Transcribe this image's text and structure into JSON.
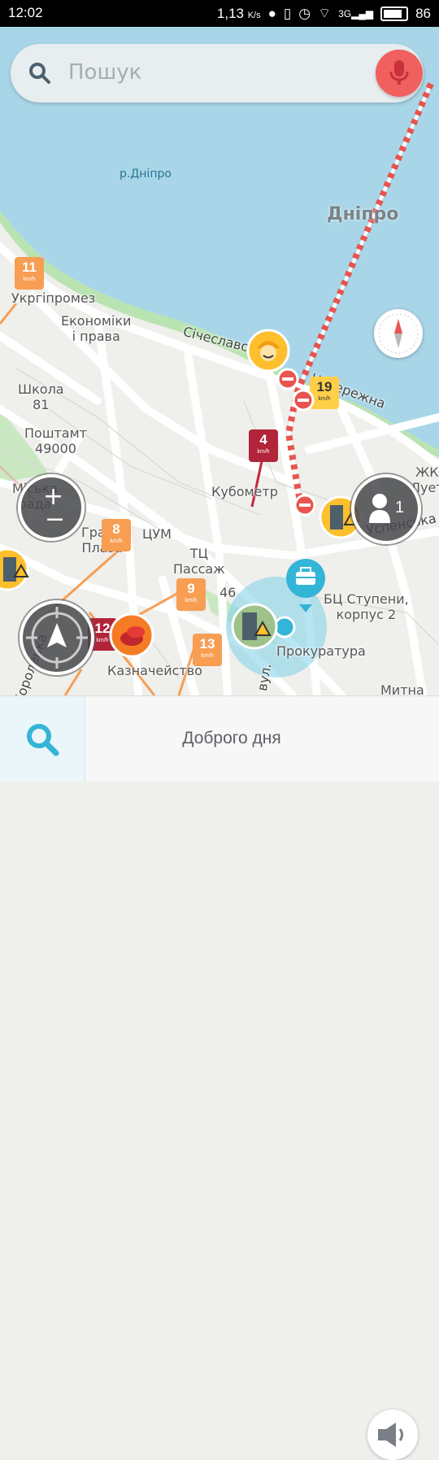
{
  "status_bar": {
    "time": "12:02",
    "speed": "1,13",
    "speed_unit": "K/s",
    "network": "3G",
    "battery": "86"
  },
  "search": {
    "placeholder": "Пошук"
  },
  "map": {
    "water_label": "р.Дніпро",
    "city_label": "Дніпро",
    "places": [
      "Укргіпромез",
      "Економіки\nі права",
      "Школа\n81",
      "Поштамт\n49000",
      "Міська\nрада",
      "Кубометр",
      "Гранд\nПлаза",
      "ЦУМ",
      "ТЦ\nПассаж",
      "46",
      "БЦ Ступени,\nкорпус 2",
      "Прокуратура",
      "Казначейство",
      "Митна",
      "ЖК\nЛует"
    ],
    "streets": [
      "Січеславська",
      "Набережна",
      "Успенська",
      "вул.",
      "Короленка"
    ],
    "speed_markers": [
      {
        "value": "11",
        "unit": "km/h",
        "color": "orange"
      },
      {
        "value": "19",
        "unit": "km/h",
        "color": "yellow"
      },
      {
        "value": "4",
        "unit": "km/h",
        "color": "red"
      },
      {
        "value": "8",
        "unit": "km/h",
        "color": "orange"
      },
      {
        "value": "9",
        "unit": "km/h",
        "color": "orange"
      },
      {
        "value": "12",
        "unit": "km/h",
        "color": "red"
      },
      {
        "value": "13",
        "unit": "km/h",
        "color": "orange"
      }
    ]
  },
  "controls": {
    "zoom_in": "+",
    "zoom_out": "−",
    "nearby_users": "1"
  },
  "bottom_bar": {
    "greeting": "Доброго дня"
  },
  "colors": {
    "water": "#a8d6e8",
    "park": "#b9e3b1",
    "mic": "#f0605f",
    "accent": "#33b5d8"
  }
}
